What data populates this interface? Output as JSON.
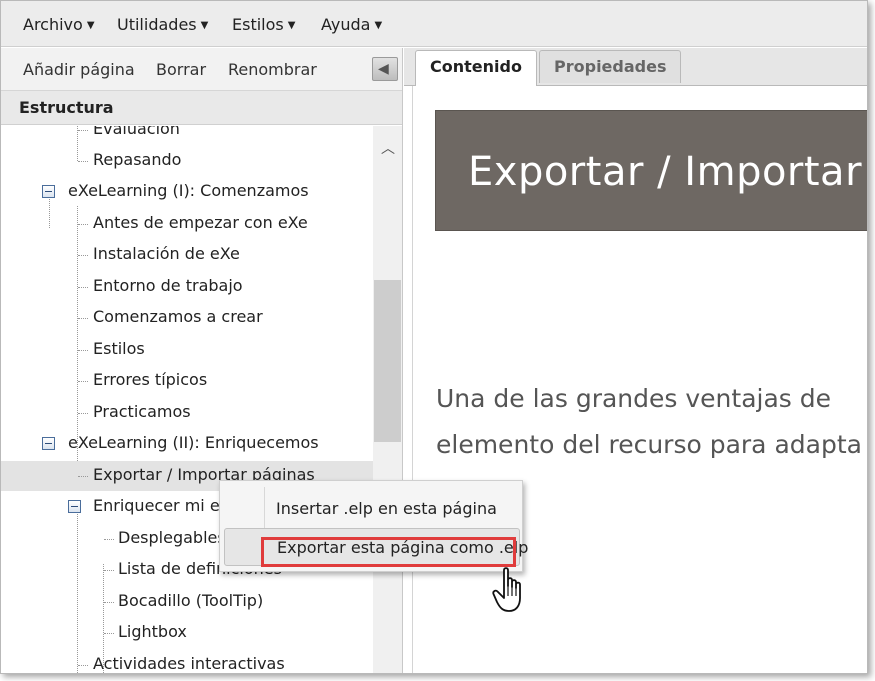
{
  "menubar": {
    "items": [
      "Archivo",
      "Utilidades",
      "Estilos",
      "Ayuda"
    ]
  },
  "left_toolbar": {
    "add_page": "Añadir página",
    "delete": "Borrar",
    "rename": "Renombrar"
  },
  "structure": {
    "header": "Estructura",
    "items": [
      {
        "label": "Evaluación"
      },
      {
        "label": "Repasando"
      },
      {
        "label": "eXeLearning (I): Comenzamos"
      },
      {
        "label": "Antes de empezar con eXe"
      },
      {
        "label": "Instalación de eXe"
      },
      {
        "label": "Entorno de trabajo"
      },
      {
        "label": "Comenzamos a crear"
      },
      {
        "label": "Estilos"
      },
      {
        "label": "Errores típicos"
      },
      {
        "label": "Practicamos"
      },
      {
        "label": "eXeLearning (II): Enriquecemos"
      },
      {
        "label": "Exportar / Importar páginas"
      },
      {
        "label": "Enriquecer mi elp"
      },
      {
        "label": "Desplegables"
      },
      {
        "label": "Lista de definiciones"
      },
      {
        "label": "Bocadillo (ToolTip)"
      },
      {
        "label": "Lightbox"
      },
      {
        "label": "Actividades interactivas"
      }
    ]
  },
  "tabs": [
    "Contenido",
    "Propiedades"
  ],
  "content": {
    "page_title": "Exportar / Importar",
    "paragraph_line1": "Una de las grandes ventajas de",
    "paragraph_line2": "elemento del recurso para adapta"
  },
  "context_menu": {
    "items": [
      "Insertar .elp en esta página",
      "Exportar esta página como .elp"
    ]
  },
  "colors": {
    "banner": "#6e6863",
    "highlight": "#e03c3c"
  }
}
